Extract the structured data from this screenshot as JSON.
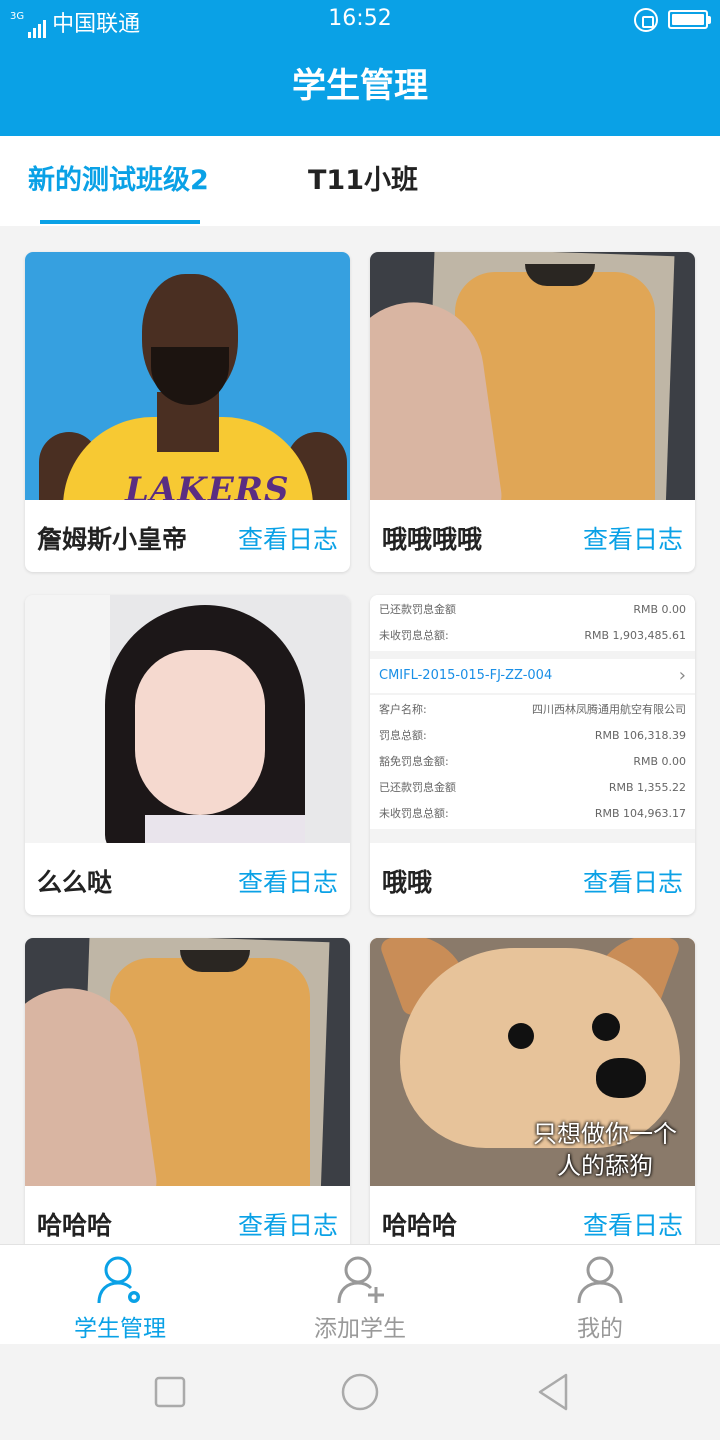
{
  "status_bar": {
    "network": "3G",
    "carrier": "中国联通",
    "time": "16:52"
  },
  "header": {
    "title": "学生管理"
  },
  "tabs": [
    {
      "label": "新的测试班级2",
      "active": true
    },
    {
      "label": "T11小班",
      "active": false
    }
  ],
  "students": [
    {
      "name": "詹姆斯小皇帝",
      "link": "查看日志",
      "photo": "basketball-player-photo"
    },
    {
      "name": "哦哦哦哦",
      "link": "查看日志",
      "photo": "hand-holding-shirt-photo"
    },
    {
      "name": "么么哒",
      "link": "查看日志",
      "photo": "girl-portrait-photo"
    },
    {
      "name": "哦哦",
      "link": "查看日志",
      "photo": "receipt-screenshot"
    },
    {
      "name": "哈哈哈",
      "link": "查看日志",
      "photo": "hand-holding-shirt-photo"
    },
    {
      "name": "哈哈哈",
      "link": "查看日志",
      "photo": "shiba-dog-meme"
    }
  ],
  "receipt": {
    "rows_top": [
      {
        "label": "已还款罚息金额",
        "value": "RMB 0.00"
      },
      {
        "label": "未收罚息总额:",
        "value": "RMB 1,903,485.61"
      }
    ],
    "contract_id": "CMIFL-2015-015-FJ-ZZ-004",
    "rows_bottom": [
      {
        "label": "客户名称:",
        "value": "四川西林凤腾通用航空有限公司"
      },
      {
        "label": "罚息总额:",
        "value": "RMB 106,318.39"
      },
      {
        "label": "豁免罚息金额:",
        "value": "RMB 0.00"
      },
      {
        "label": "已还款罚息金额",
        "value": "RMB 1,355.22"
      },
      {
        "label": "未收罚息总额:",
        "value": "RMB 104,963.17"
      }
    ]
  },
  "meme_caption": {
    "line1": "只想做你一个",
    "line2": "人的舔狗"
  },
  "jersey_text": "LAKERS",
  "bottom_nav": [
    {
      "label": "学生管理",
      "icon": "user-settings-icon",
      "active": true
    },
    {
      "label": "添加学生",
      "icon": "user-add-icon",
      "active": false
    },
    {
      "label": "我的",
      "icon": "user-icon",
      "active": false
    }
  ],
  "colors": {
    "primary": "#0aa1e6",
    "inactive": "#999999"
  }
}
